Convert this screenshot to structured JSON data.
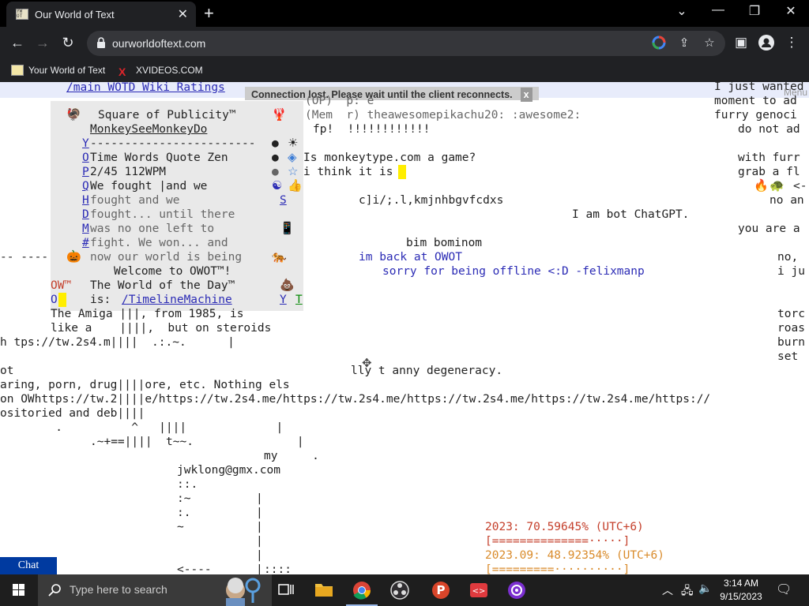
{
  "browser": {
    "tab_title": "Our World of Text",
    "url": "ourworldoftext.com",
    "bookmarks": [
      "Your World of Text",
      "XVIDEOS.COM"
    ]
  },
  "owot": {
    "nav_links": "/main WOTD Wiki Ratings",
    "connection_banner": "Connection lost. Please wait until the client reconnects.",
    "connection_close": "x",
    "menu_label": "Menu",
    "publicity": {
      "title": "Square of Publicity™",
      "user": "MonkeySeeMonkeyDo",
      "dash_line": "------------------------",
      "typing_mode": "Time Words Quote Zen",
      "progress": "2/45 112WPM",
      "quote_lines": [
        "We fought |and we",
        "fought and we",
        "fought... until there",
        "was no one left to",
        "fight. We won... and",
        "now our world is being"
      ],
      "side_letters": [
        "Y",
        "O",
        "P",
        "Q",
        "H",
        "D",
        "M",
        "#"
      ],
      "welcome": "Welcome to OWOT™!",
      "wotd_label": "The World of the Day™",
      "wotd_is": "is:",
      "wotd_link": "/TimelineMachine",
      "ow_label": "OW™",
      "o_label": "O",
      "s_label": "S",
      "y_label": "Y",
      "t_label": "T"
    },
    "lines": {
      "op_line": "(OP)  p: e",
      "mem_line": "(Mem  r) theawesomepikachu20: :awesome2:",
      "fp_line": "fp!  !!!!!!!!!!!!",
      "q1": "Is monkeytype.com a game?",
      "q2": "i think it is",
      "garble": "c]i/;.l,kmjnhbgvfcdxs",
      "bot": "I am bot ChatGPT.",
      "bim": "bim bominom",
      "back": "im back at OWOT",
      "sorry": "sorry for being offline <:D -felixmanp",
      "amiga1": "The Amiga |||, from 1985, is",
      "amiga2": "like a    ||||,  but on steroids",
      "tps": "h tps://tw.2s4.m||||  .:.~.      |",
      "ot": "ot",
      "degeneracy": "lly t anny degeneracy.",
      "sharing": "aring, porn, drug||||ore, etc. Nothing els",
      "ow_links": "on OWhttps://tw.2||||e/https://tw.2s4.me/https://tw.2s4.me/https://tw.2s4.me/https://tw.2s4.me/https://",
      "repos": "ositoried and deb||||",
      "dot_line": "   .          ^   ||||             |",
      "plus_line": ".~+==||||  t~~.               |",
      "my": "my     .",
      "email": "jwklong@gmx.com",
      "colon1": "::.",
      "colon2": ":~",
      "colon3": ":.",
      "tilde": "~",
      "arrow": "<----",
      "dots4": "::::",
      "dashes_left": "-- ----",
      "right1": "I just wanted",
      "right2": "moment to ad",
      "right3": "furry genoci",
      "right4": "do not ad",
      "right5": "with furr",
      "right6": "grab a fl",
      "right7": "<-",
      "right8": "no an",
      "right9": "you are a",
      "right10": "no,",
      "right11": "i ju",
      "right12": "torc",
      "right13": "roas",
      "right14": "burn",
      "right15": "set",
      "stat1": "2023: 70.59645% (UTC+6)",
      "bar1": "[==============·····]",
      "stat2": "2023.09: 48.92354% (UTC+6)",
      "bar2": "[=========··········]"
    },
    "chat_label": "Chat"
  },
  "taskbar": {
    "search_placeholder": "Type here to search",
    "time": "3:14 AM",
    "date": "9/15/2023"
  }
}
